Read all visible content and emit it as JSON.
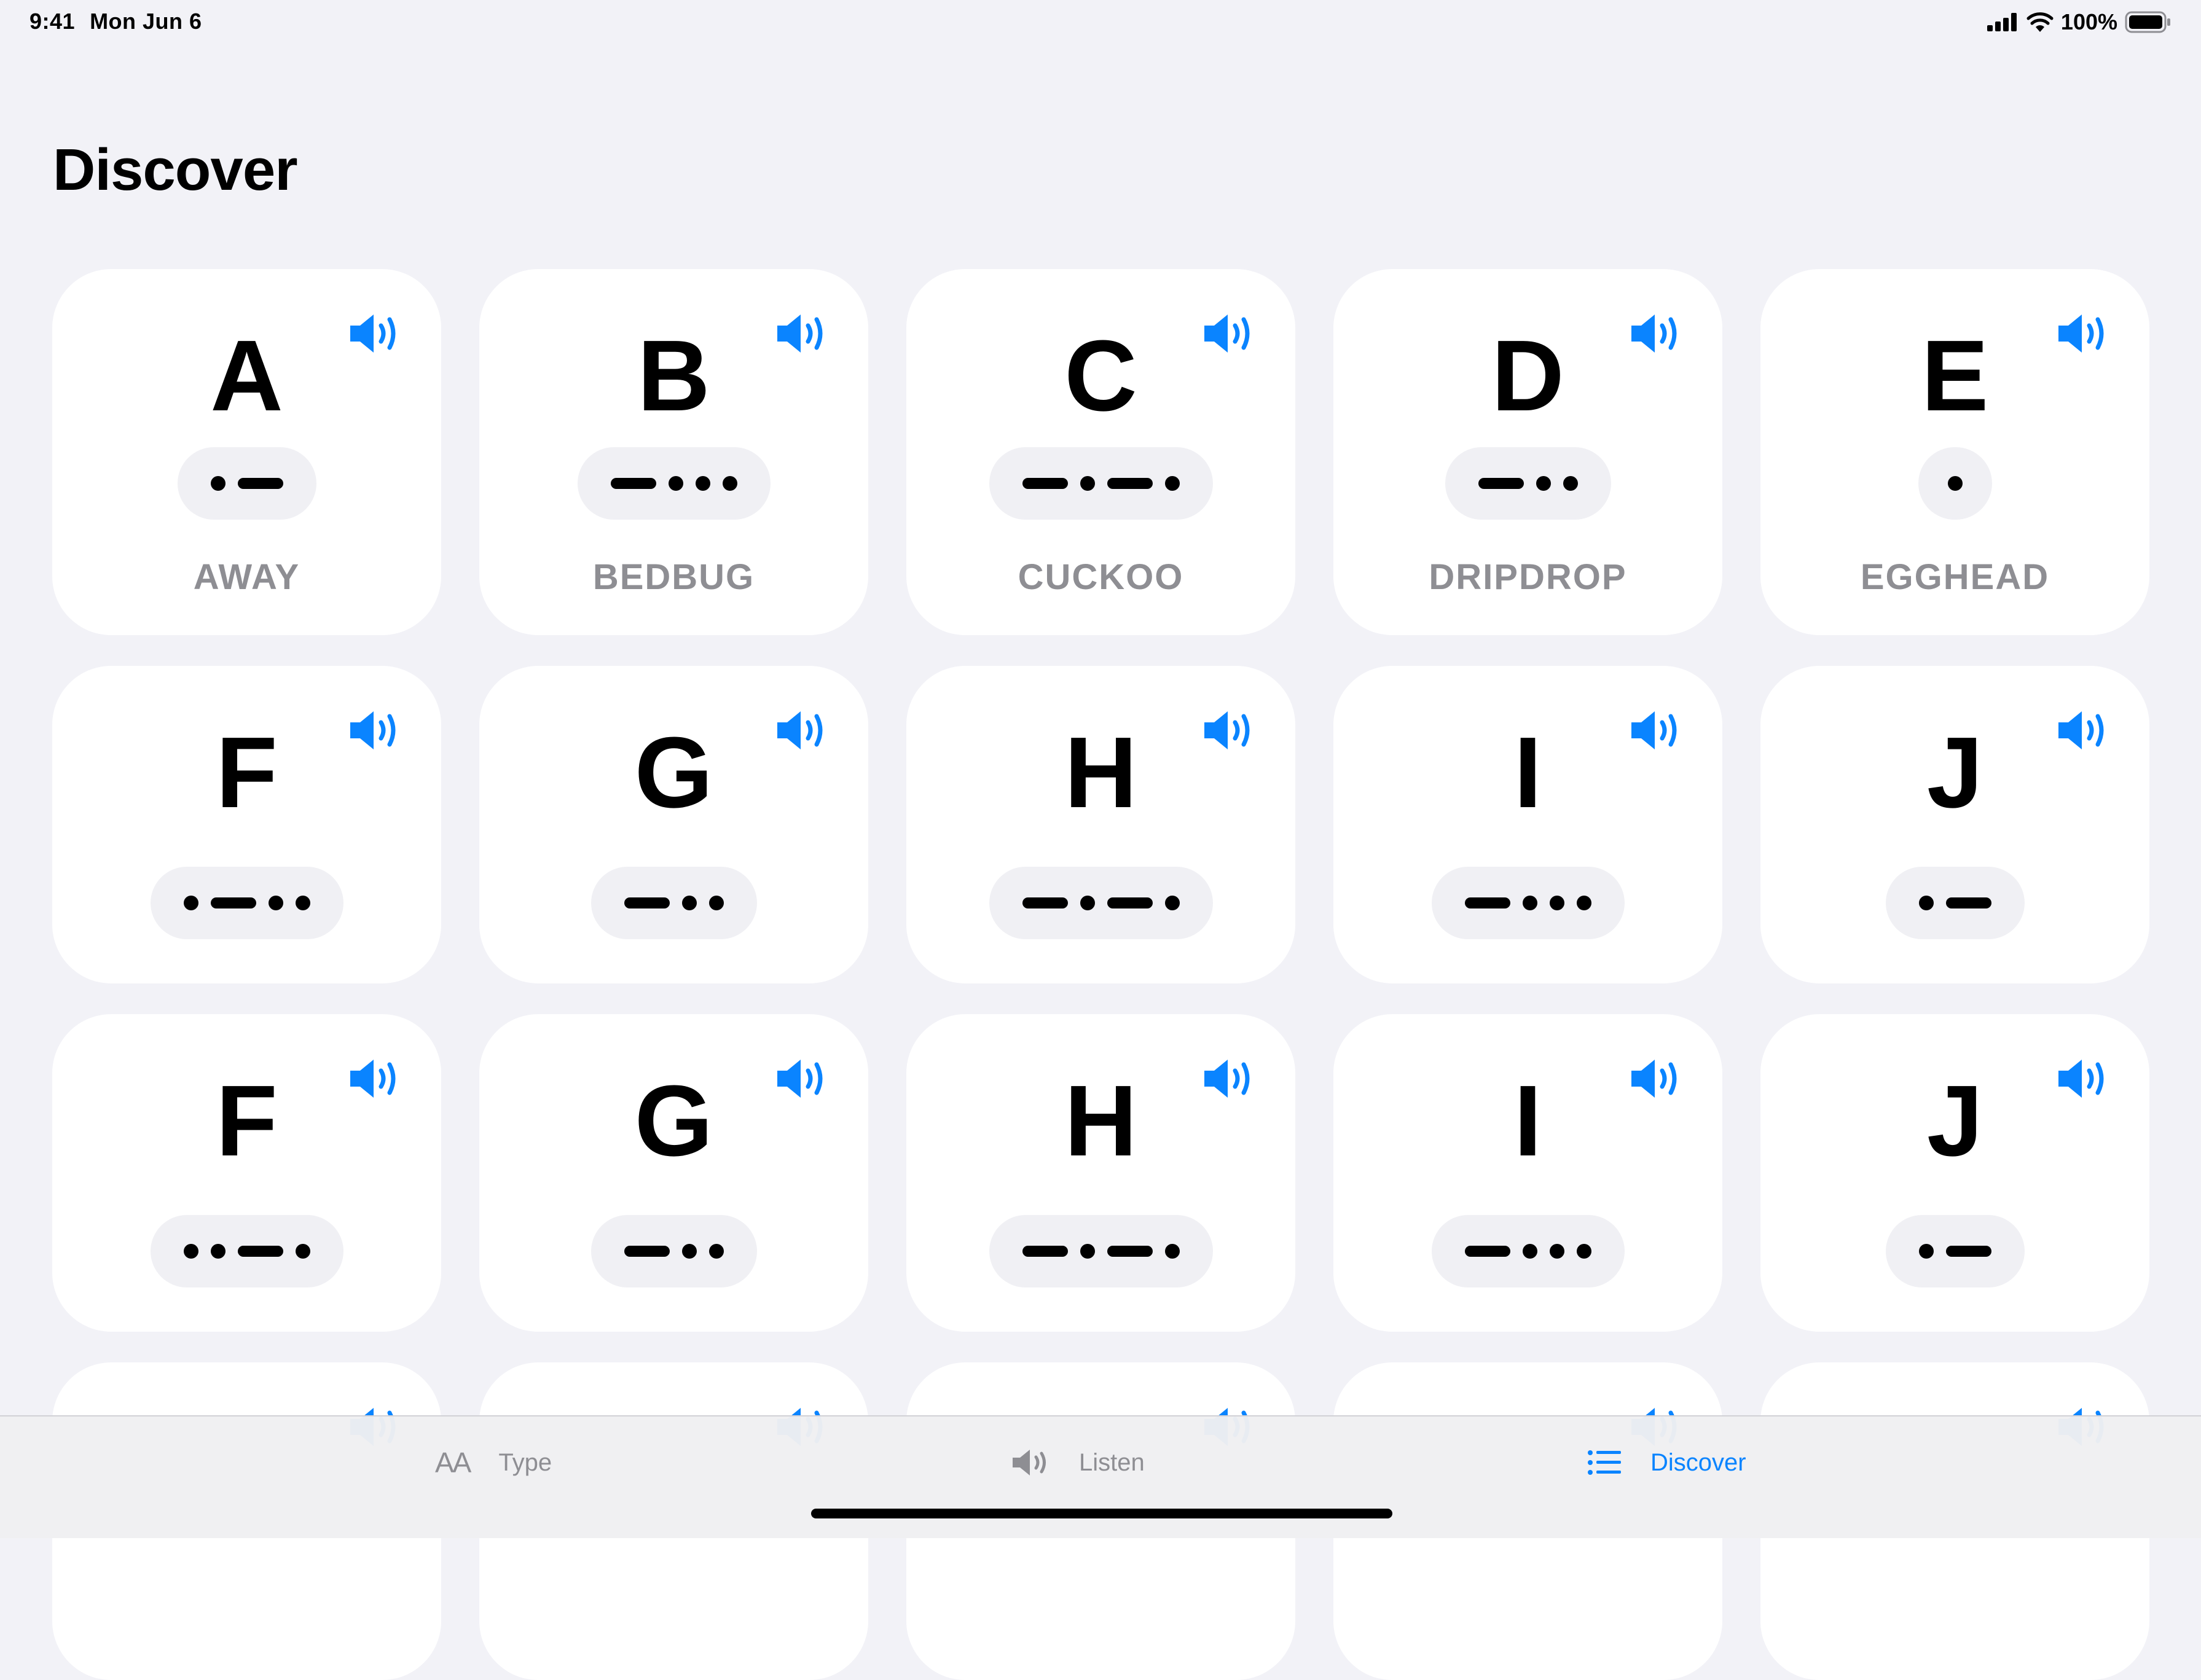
{
  "status_bar": {
    "time": "9:41",
    "date": "Mon Jun 6",
    "battery": "100%"
  },
  "page": {
    "title": "Discover"
  },
  "colors": {
    "accent": "#0a84ff",
    "background": "#f2f2f7",
    "card": "#ffffff",
    "secondary_text": "#8e8e93"
  },
  "cards": [
    {
      "letter": "A",
      "morse": ".-",
      "mnemonic": "AWAY"
    },
    {
      "letter": "B",
      "morse": "-...",
      "mnemonic": "BEDBUG"
    },
    {
      "letter": "C",
      "morse": "-.-.",
      "mnemonic": "CUCKOO"
    },
    {
      "letter": "D",
      "morse": "-..",
      "mnemonic": "DRIPDROP"
    },
    {
      "letter": "E",
      "morse": ".",
      "mnemonic": "EGGHEAD"
    },
    {
      "letter": "F",
      "morse": ".-..",
      "mnemonic": ""
    },
    {
      "letter": "G",
      "morse": "-..",
      "mnemonic": ""
    },
    {
      "letter": "H",
      "morse": "-.-.",
      "mnemonic": ""
    },
    {
      "letter": "I",
      "morse": "-...",
      "mnemonic": ""
    },
    {
      "letter": "J",
      "morse": ".-",
      "mnemonic": ""
    },
    {
      "letter": "F",
      "morse": "..-.",
      "mnemonic": ""
    },
    {
      "letter": "G",
      "morse": "-..",
      "mnemonic": ""
    },
    {
      "letter": "H",
      "morse": "-.-.",
      "mnemonic": ""
    },
    {
      "letter": "I",
      "morse": "-...",
      "mnemonic": ""
    },
    {
      "letter": "J",
      "morse": ".-",
      "mnemonic": ""
    }
  ],
  "partial_row_visible": true,
  "tab_bar": {
    "tabs": [
      {
        "name": "type",
        "label": "Type",
        "icon_label": "AA",
        "icon": "text-size-icon",
        "active": false
      },
      {
        "name": "listen",
        "label": "Listen",
        "icon": "speaker-icon",
        "active": false
      },
      {
        "name": "discover",
        "label": "Discover",
        "icon": "list-icon",
        "active": true
      }
    ]
  }
}
